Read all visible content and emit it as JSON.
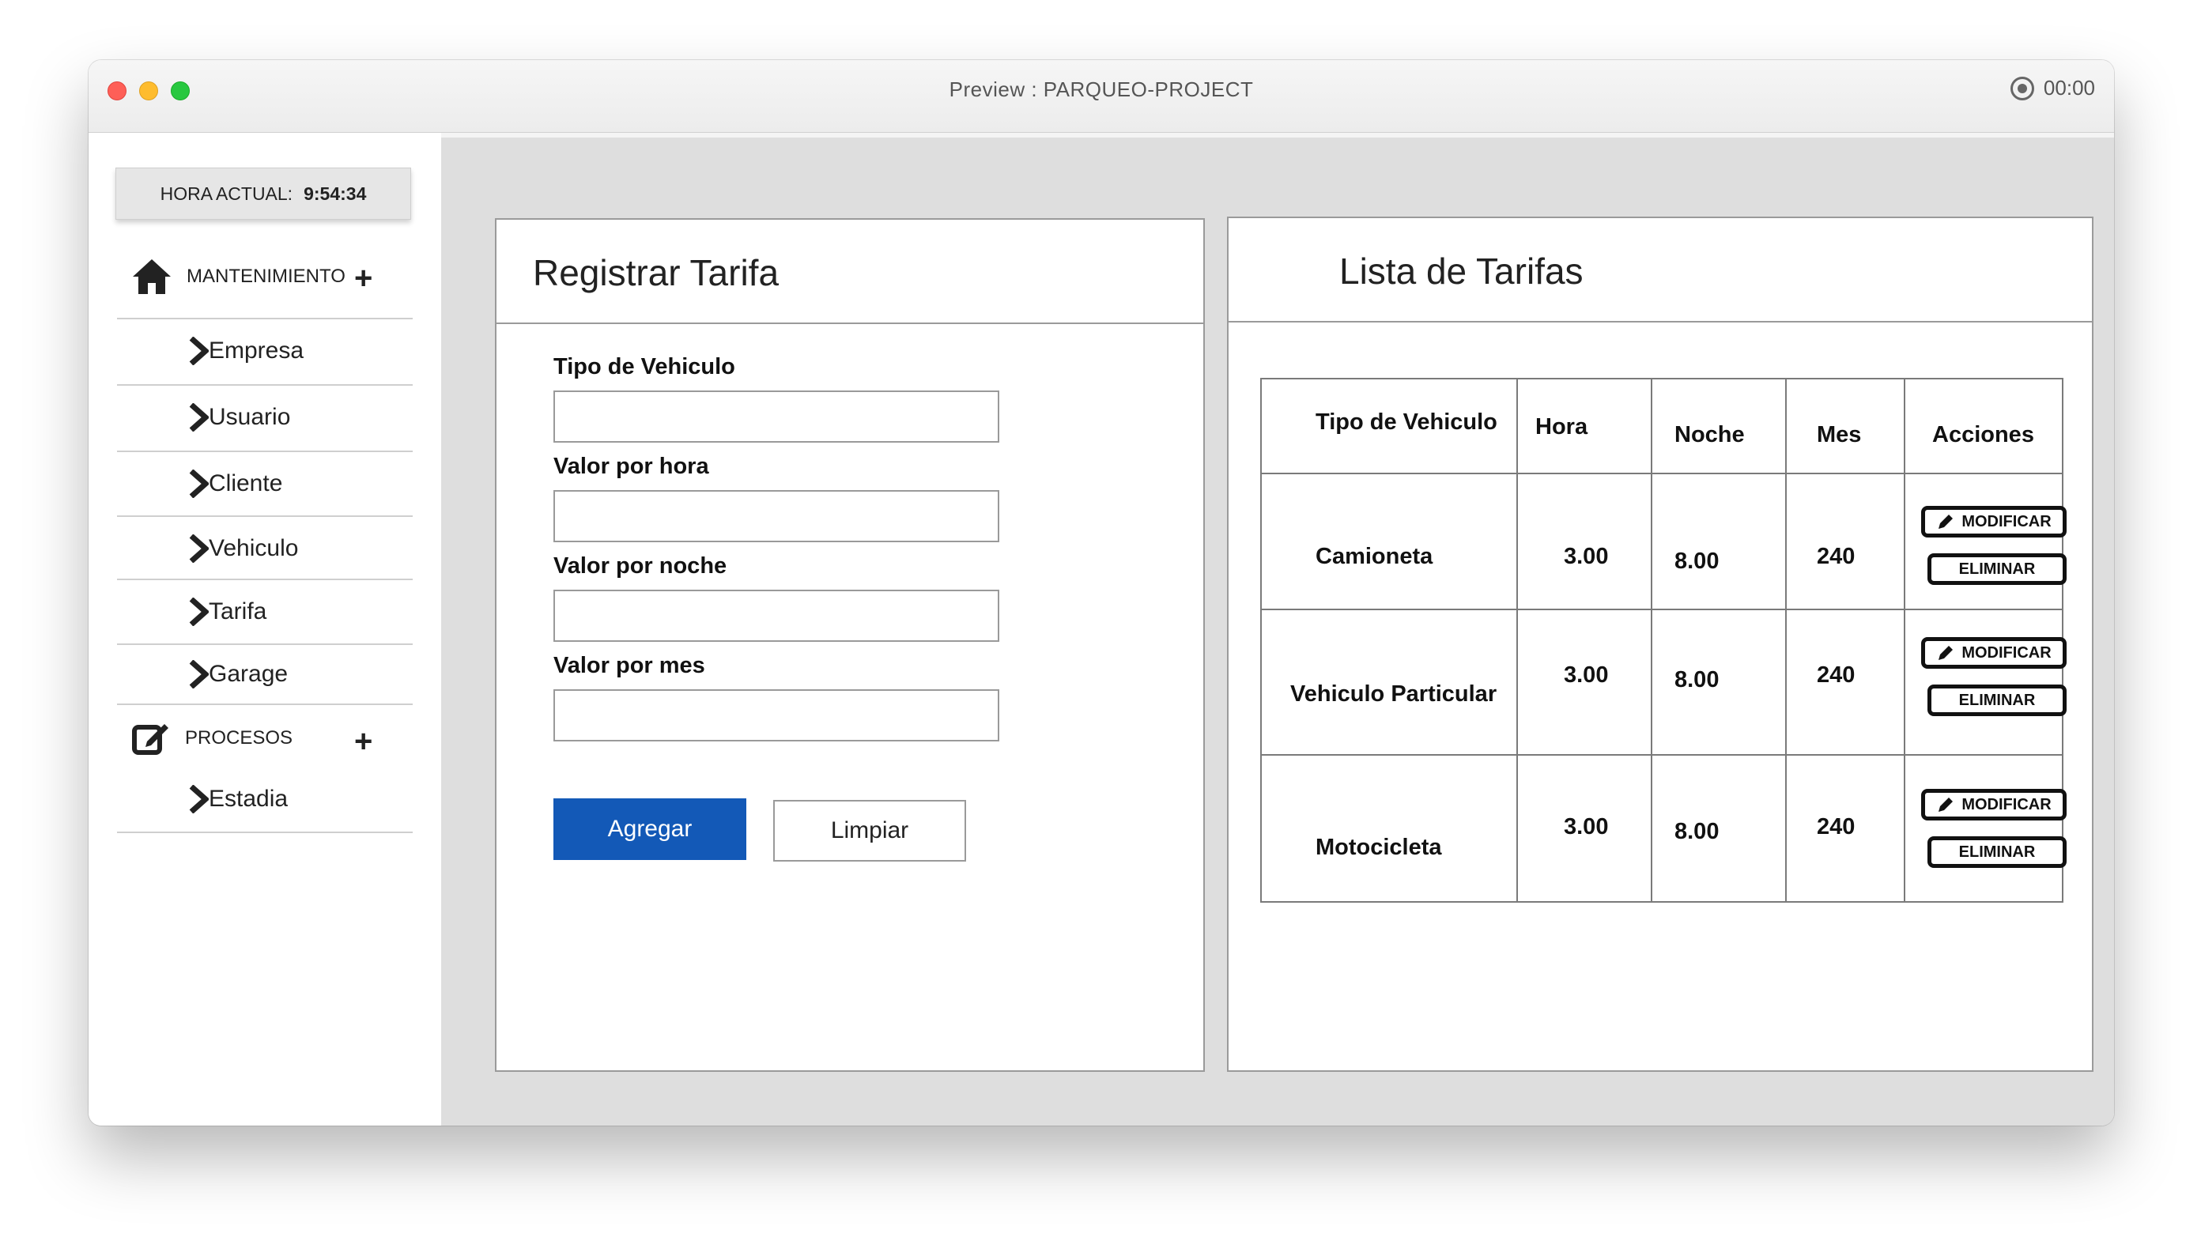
{
  "window": {
    "title": "Preview : PARQUEO-PROJECT",
    "timer": "00:00"
  },
  "sidebar": {
    "clock": {
      "label": "HORA ACTUAL:",
      "time": "9:54:34"
    },
    "mantenimiento": {
      "label": "MANTENIMIENTO",
      "items": [
        {
          "label": "Empresa"
        },
        {
          "label": "Usuario"
        },
        {
          "label": "Cliente"
        },
        {
          "label": "Vehiculo"
        },
        {
          "label": "Tarifa"
        },
        {
          "label": "Garage"
        }
      ]
    },
    "procesos": {
      "label": "PROCESOS",
      "items": [
        {
          "label": "Estadia"
        }
      ]
    }
  },
  "form": {
    "title": "Registrar Tarifa",
    "fields": [
      {
        "label": "Tipo de Vehiculo",
        "value": ""
      },
      {
        "label": "Valor por hora",
        "value": ""
      },
      {
        "label": "Valor por noche",
        "value": ""
      },
      {
        "label": "Valor por mes",
        "value": ""
      }
    ],
    "add_label": "Agregar",
    "clear_label": "Limpiar"
  },
  "list": {
    "title": "Lista de Tarifas",
    "columns": [
      "Tipo de Vehiculo",
      "Hora",
      "Noche",
      "Mes",
      "Acciones"
    ],
    "rows": [
      {
        "tipo": "Camioneta",
        "hora": "3.00",
        "noche": "8.00",
        "mes": "240"
      },
      {
        "tipo": "Vehiculo Particular",
        "hora": "3.00",
        "noche": "8.00",
        "mes": "240"
      },
      {
        "tipo": "Motocicleta",
        "hora": "3.00",
        "noche": "8.00",
        "mes": "240"
      }
    ],
    "modify_label": "MODIFICAR",
    "delete_label": "ELIMINAR"
  }
}
